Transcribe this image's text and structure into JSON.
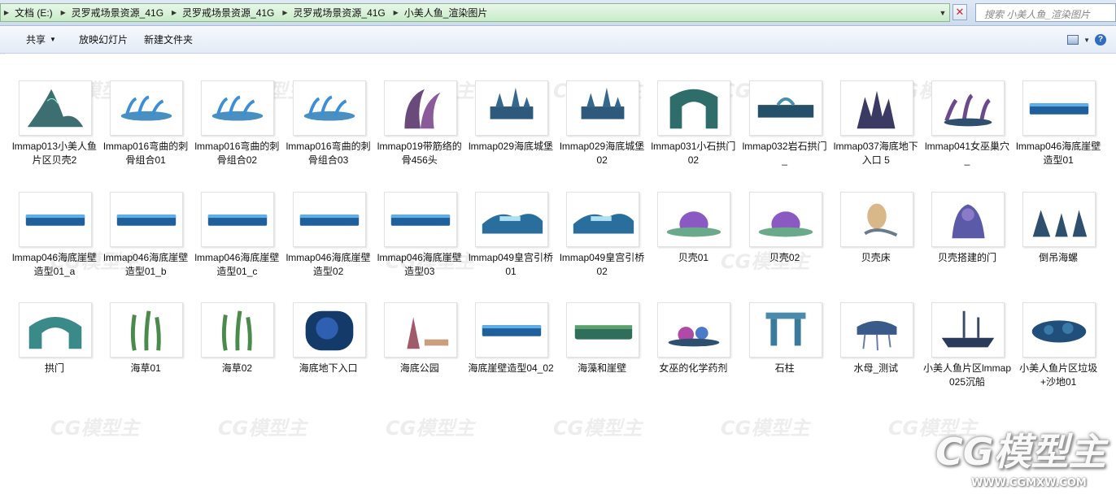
{
  "address_bar": {
    "crumbs": [
      "文档 (E:)",
      "灵罗戒场景资源_41G",
      "灵罗戒场景资源_41G",
      "灵罗戒场景资源_41G",
      "小美人鱼_渲染图片"
    ],
    "search_placeholder": "搜索 小美人鱼_渲染图片"
  },
  "toolbar": {
    "share_label": "共享",
    "slideshow_label": "放映幻灯片",
    "new_folder_label": "新建文件夹"
  },
  "files": [
    {
      "label": "lmmap013小美人鱼片区贝壳2",
      "icon": "shell-rock-render-icon"
    },
    {
      "label": "lmmap016弯曲的刺骨组合01",
      "icon": "curved-spine-render-icon"
    },
    {
      "label": "lmmap016弯曲的刺骨组合02",
      "icon": "curved-spine-render-icon"
    },
    {
      "label": "lmmap016弯曲的刺骨组合03",
      "icon": "curved-spine-render-icon"
    },
    {
      "label": "lmmap019带筋络的骨456头",
      "icon": "ribbed-bone-render-icon"
    },
    {
      "label": "lmmap029海底城堡",
      "icon": "undersea-castle-render-icon"
    },
    {
      "label": "lmmap029海底城堡02",
      "icon": "undersea-castle-render-icon"
    },
    {
      "label": "lmmap031小石拱门02",
      "icon": "stone-arch-render-icon"
    },
    {
      "label": "lmmap032岩石拱门_",
      "icon": "rock-arch-render-icon"
    },
    {
      "label": "lmmap037海底地下入口 5",
      "icon": "coral-entrance-render-icon"
    },
    {
      "label": "lmmap041女巫巢穴_",
      "icon": "witch-lair-render-icon"
    },
    {
      "label": "lmmap046海底崖壁造型01",
      "icon": "cliff-wall-render-icon"
    },
    {
      "label": "lmmap046海底崖壁造型01_a",
      "icon": "cliff-wall-render-icon"
    },
    {
      "label": "lmmap046海底崖壁造型01_b",
      "icon": "cliff-wall-render-icon"
    },
    {
      "label": "lmmap046海底崖壁造型01_c",
      "icon": "cliff-wall-render-icon"
    },
    {
      "label": "lmmap046海底崖壁造型02",
      "icon": "cliff-wall-render-icon"
    },
    {
      "label": "lmmap046海底崖壁造型03",
      "icon": "cliff-wall-render-icon"
    },
    {
      "label": "lmmap049皇宫引桥01",
      "icon": "palace-bridge-render-icon"
    },
    {
      "label": "lmmap049皇宫引桥02",
      "icon": "palace-bridge-render-icon"
    },
    {
      "label": "贝壳01",
      "icon": "shell-render-icon"
    },
    {
      "label": "贝壳02",
      "icon": "shell-render-icon"
    },
    {
      "label": "贝壳床",
      "icon": "shell-bed-render-icon"
    },
    {
      "label": "贝壳搭建的门",
      "icon": "shell-gate-render-icon"
    },
    {
      "label": "倒吊海螺",
      "icon": "hanging-conch-render-icon"
    },
    {
      "label": "拱门",
      "icon": "arch-render-icon"
    },
    {
      "label": "海草01",
      "icon": "seaweed-render-icon"
    },
    {
      "label": "海草02",
      "icon": "seaweed-render-icon"
    },
    {
      "label": "海底地下入口",
      "icon": "underground-entrance-render-icon"
    },
    {
      "label": "海底公园",
      "icon": "undersea-park-render-icon"
    },
    {
      "label": "海底崖壁造型04_02",
      "icon": "cliff-wall-render-icon"
    },
    {
      "label": "海藻和崖壁",
      "icon": "algae-cliff-render-icon"
    },
    {
      "label": "女巫的化学药剂",
      "icon": "witch-potion-render-icon"
    },
    {
      "label": "石柱",
      "icon": "stone-pillar-render-icon"
    },
    {
      "label": "水母_测试",
      "icon": "jellyfish-render-icon"
    },
    {
      "label": "小美人鱼片区lmmap025沉船",
      "icon": "shipwreck-render-icon"
    },
    {
      "label": "小美人鱼片区垃圾+沙地01",
      "icon": "junk-sand-render-icon"
    }
  ],
  "watermark": {
    "text": "CG模型主",
    "url": "WWW.CGMXW.COM"
  }
}
